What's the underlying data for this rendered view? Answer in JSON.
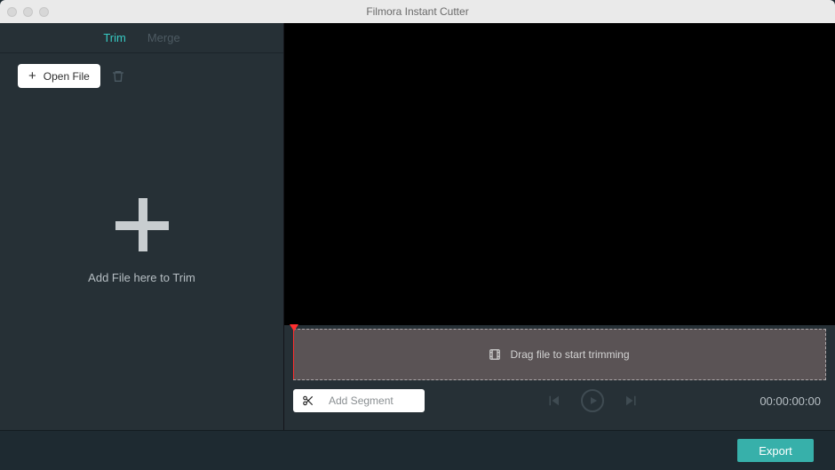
{
  "window": {
    "title": "Filmora Instant Cutter"
  },
  "tabs": {
    "trim": "Trim",
    "merge": "Merge",
    "active": "trim"
  },
  "sidebar": {
    "open_file_label": "Open File",
    "drop_label": "Add File here to Trim"
  },
  "timeline": {
    "hint": "Drag file to start trimming"
  },
  "controls": {
    "add_segment_label": "Add Segment",
    "timecode": "00:00:00:00"
  },
  "footer": {
    "export_label": "Export"
  }
}
